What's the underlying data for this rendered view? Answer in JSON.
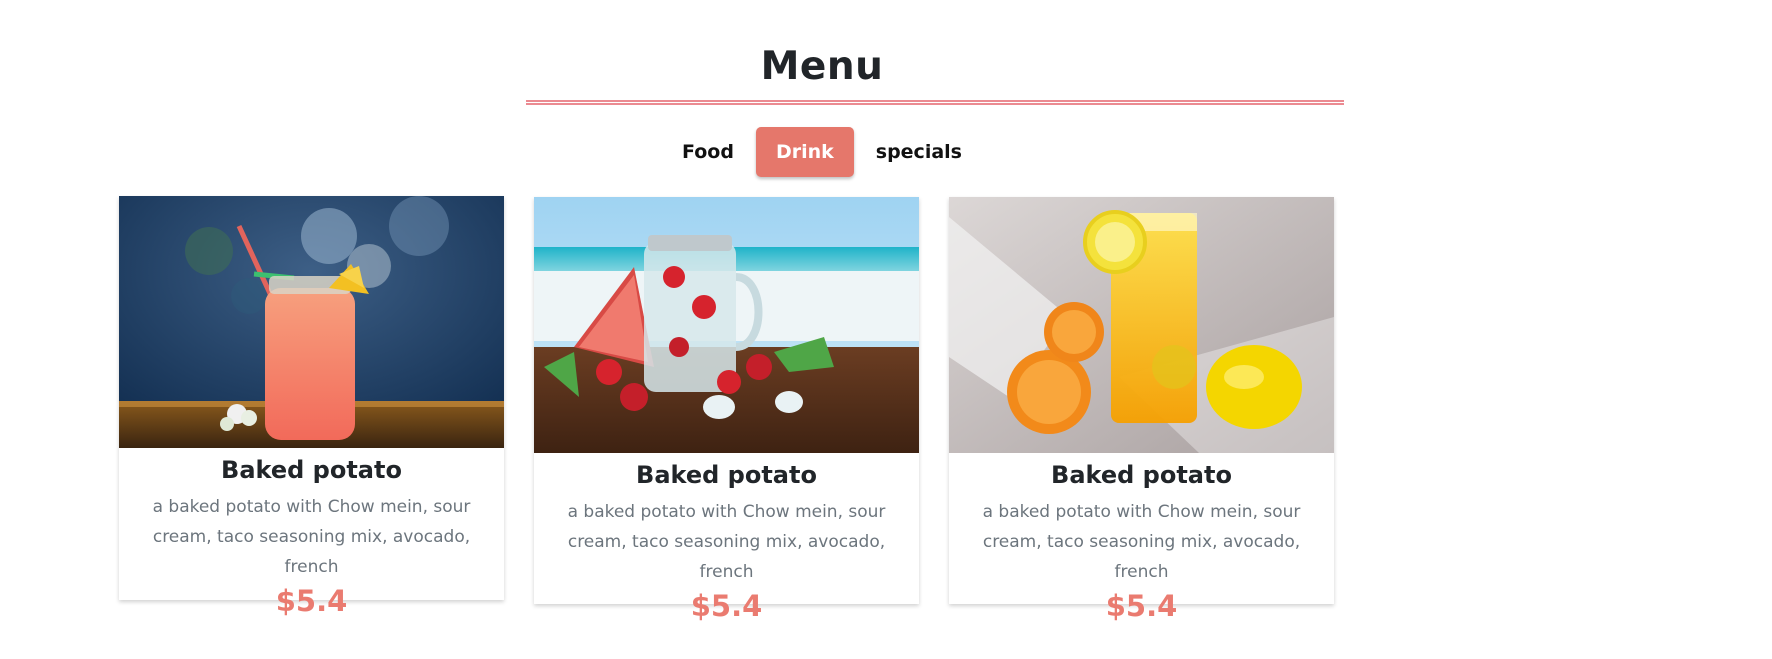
{
  "header": {
    "title": "Menu"
  },
  "tabs": [
    {
      "label": "Food",
      "active": false
    },
    {
      "label": "Drink",
      "active": true
    },
    {
      "label": "specials",
      "active": false
    }
  ],
  "accent_color": "#e5776b",
  "price_color": "#ea7b70",
  "cards": [
    {
      "image": "pink-lemonade-jar-with-straws",
      "title": "Baked potato",
      "description": "a baked potato with Chow mein, sour cream, taco seasoning mix, avocado, french",
      "price": "$5.4"
    },
    {
      "image": "strawberry-water-jar-on-beach",
      "title": "Baked potato",
      "description": "a baked potato with Chow mein, sour cream, taco seasoning mix, avocado, french",
      "price": "$5.4"
    },
    {
      "image": "orange-juice-with-lemon",
      "title": "Baked potato",
      "description": "a baked potato with Chow mein, sour cream, taco seasoning mix, avocado, french",
      "price": "$5.4"
    }
  ]
}
